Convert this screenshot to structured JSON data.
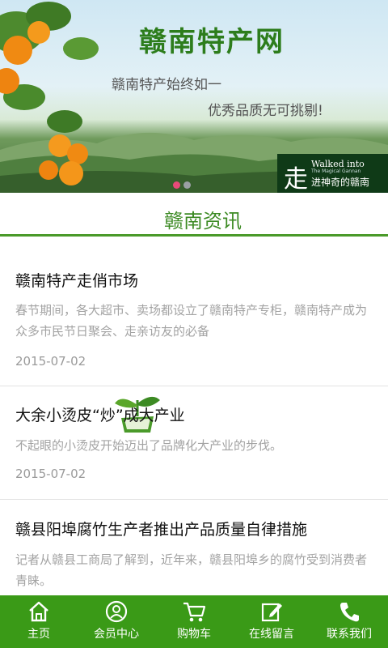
{
  "banner": {
    "title": "赣南特产网",
    "slogan_line1": "赣南特产始终如一",
    "slogan_line2": "优秀品质无可挑剔!",
    "badge_mark": "走",
    "badge_en_line1": "Walked into",
    "badge_en_line2": "The Magical Gannan",
    "badge_cn": "进神奇的赣南",
    "carousel": {
      "count": 2,
      "active": 1,
      "active_color": "#e84a7a",
      "inactive_color": "#9aa0a4"
    }
  },
  "section": {
    "title": "赣南资讯",
    "accent": "#3c8a23"
  },
  "news": [
    {
      "title": "赣南特产走俏市场",
      "summary": "春节期间，各大超市、卖场都设立了赣南特产专柜，赣南特产成为众多市民节日聚会、走亲访友的必备",
      "date": "2015-07-02"
    },
    {
      "title": "大余小烫皮“炒”成大产业",
      "summary": "不起眼的小烫皮开始迈出了品牌化大产业的步伐。",
      "date": "2015-07-02"
    },
    {
      "title": "赣县阳埠腐竹生产者推出产品质量自律措施",
      "summary": "记者从赣县工商局了解到，近年来，赣县阳埠乡的腐竹受到消费者青睐。",
      "date": ""
    }
  ],
  "bottom_nav": [
    {
      "label": "主页",
      "icon": "home-icon"
    },
    {
      "label": "会员中心",
      "icon": "user-icon"
    },
    {
      "label": "购物车",
      "icon": "cart-icon"
    },
    {
      "label": "在线留言",
      "icon": "edit-icon"
    },
    {
      "label": "联系我们",
      "icon": "phone-icon"
    }
  ],
  "colors": {
    "nav_bg": "#3a9a17",
    "section_line": "#4a9a2a"
  }
}
